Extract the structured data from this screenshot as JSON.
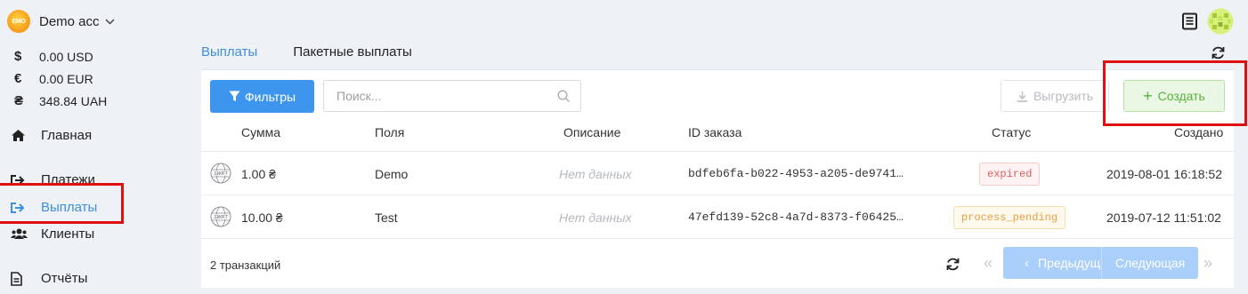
{
  "account": {
    "name": "Demo acc",
    "logo_text": "EMO"
  },
  "balances": [
    {
      "symbol": "$",
      "amount": "0.00 USD"
    },
    {
      "symbol": "€",
      "amount": "0.00 EUR"
    },
    {
      "symbol": "₴",
      "amount": "348.84 UAH"
    }
  ],
  "nav": {
    "home": "Главная",
    "payments": "Платежи",
    "payouts": "Выплаты",
    "clients": "Клиенты",
    "reports": "Отчёты"
  },
  "tabs": {
    "payouts": "Выплаты",
    "batch": "Пакетные выплаты"
  },
  "toolbar": {
    "filters": "Фильтры",
    "search_placeholder": "Поиск...",
    "export": "Выгрузить",
    "create": "Создать"
  },
  "columns": {
    "amount": "Сумма",
    "fields": "Поля",
    "description": "Описание",
    "order_id": "ID заказа",
    "status": "Статус",
    "created": "Создано"
  },
  "rows": [
    {
      "amount": "1.00 ₴",
      "fields": "Demo",
      "description": "Нет данных",
      "order_id": "bdfeb6fa-b022-4953-a205-de9741…",
      "status": "expired",
      "created": "2019-08-01 16:18:52"
    },
    {
      "amount": "10.00 ₴",
      "fields": "Test",
      "description": "Нет данных",
      "order_id": "47efd139-52c8-4a7d-8373-f06425…",
      "status": "process_pending",
      "created": "2019-07-12 11:51:02"
    }
  ],
  "footer": {
    "count": "2 транзакций",
    "prev": "Предыдущая",
    "next": "Следующая"
  },
  "colors": {
    "accent": "#3d95ee",
    "create_green": "#5cb03d",
    "highlight_red": "#e01010"
  }
}
